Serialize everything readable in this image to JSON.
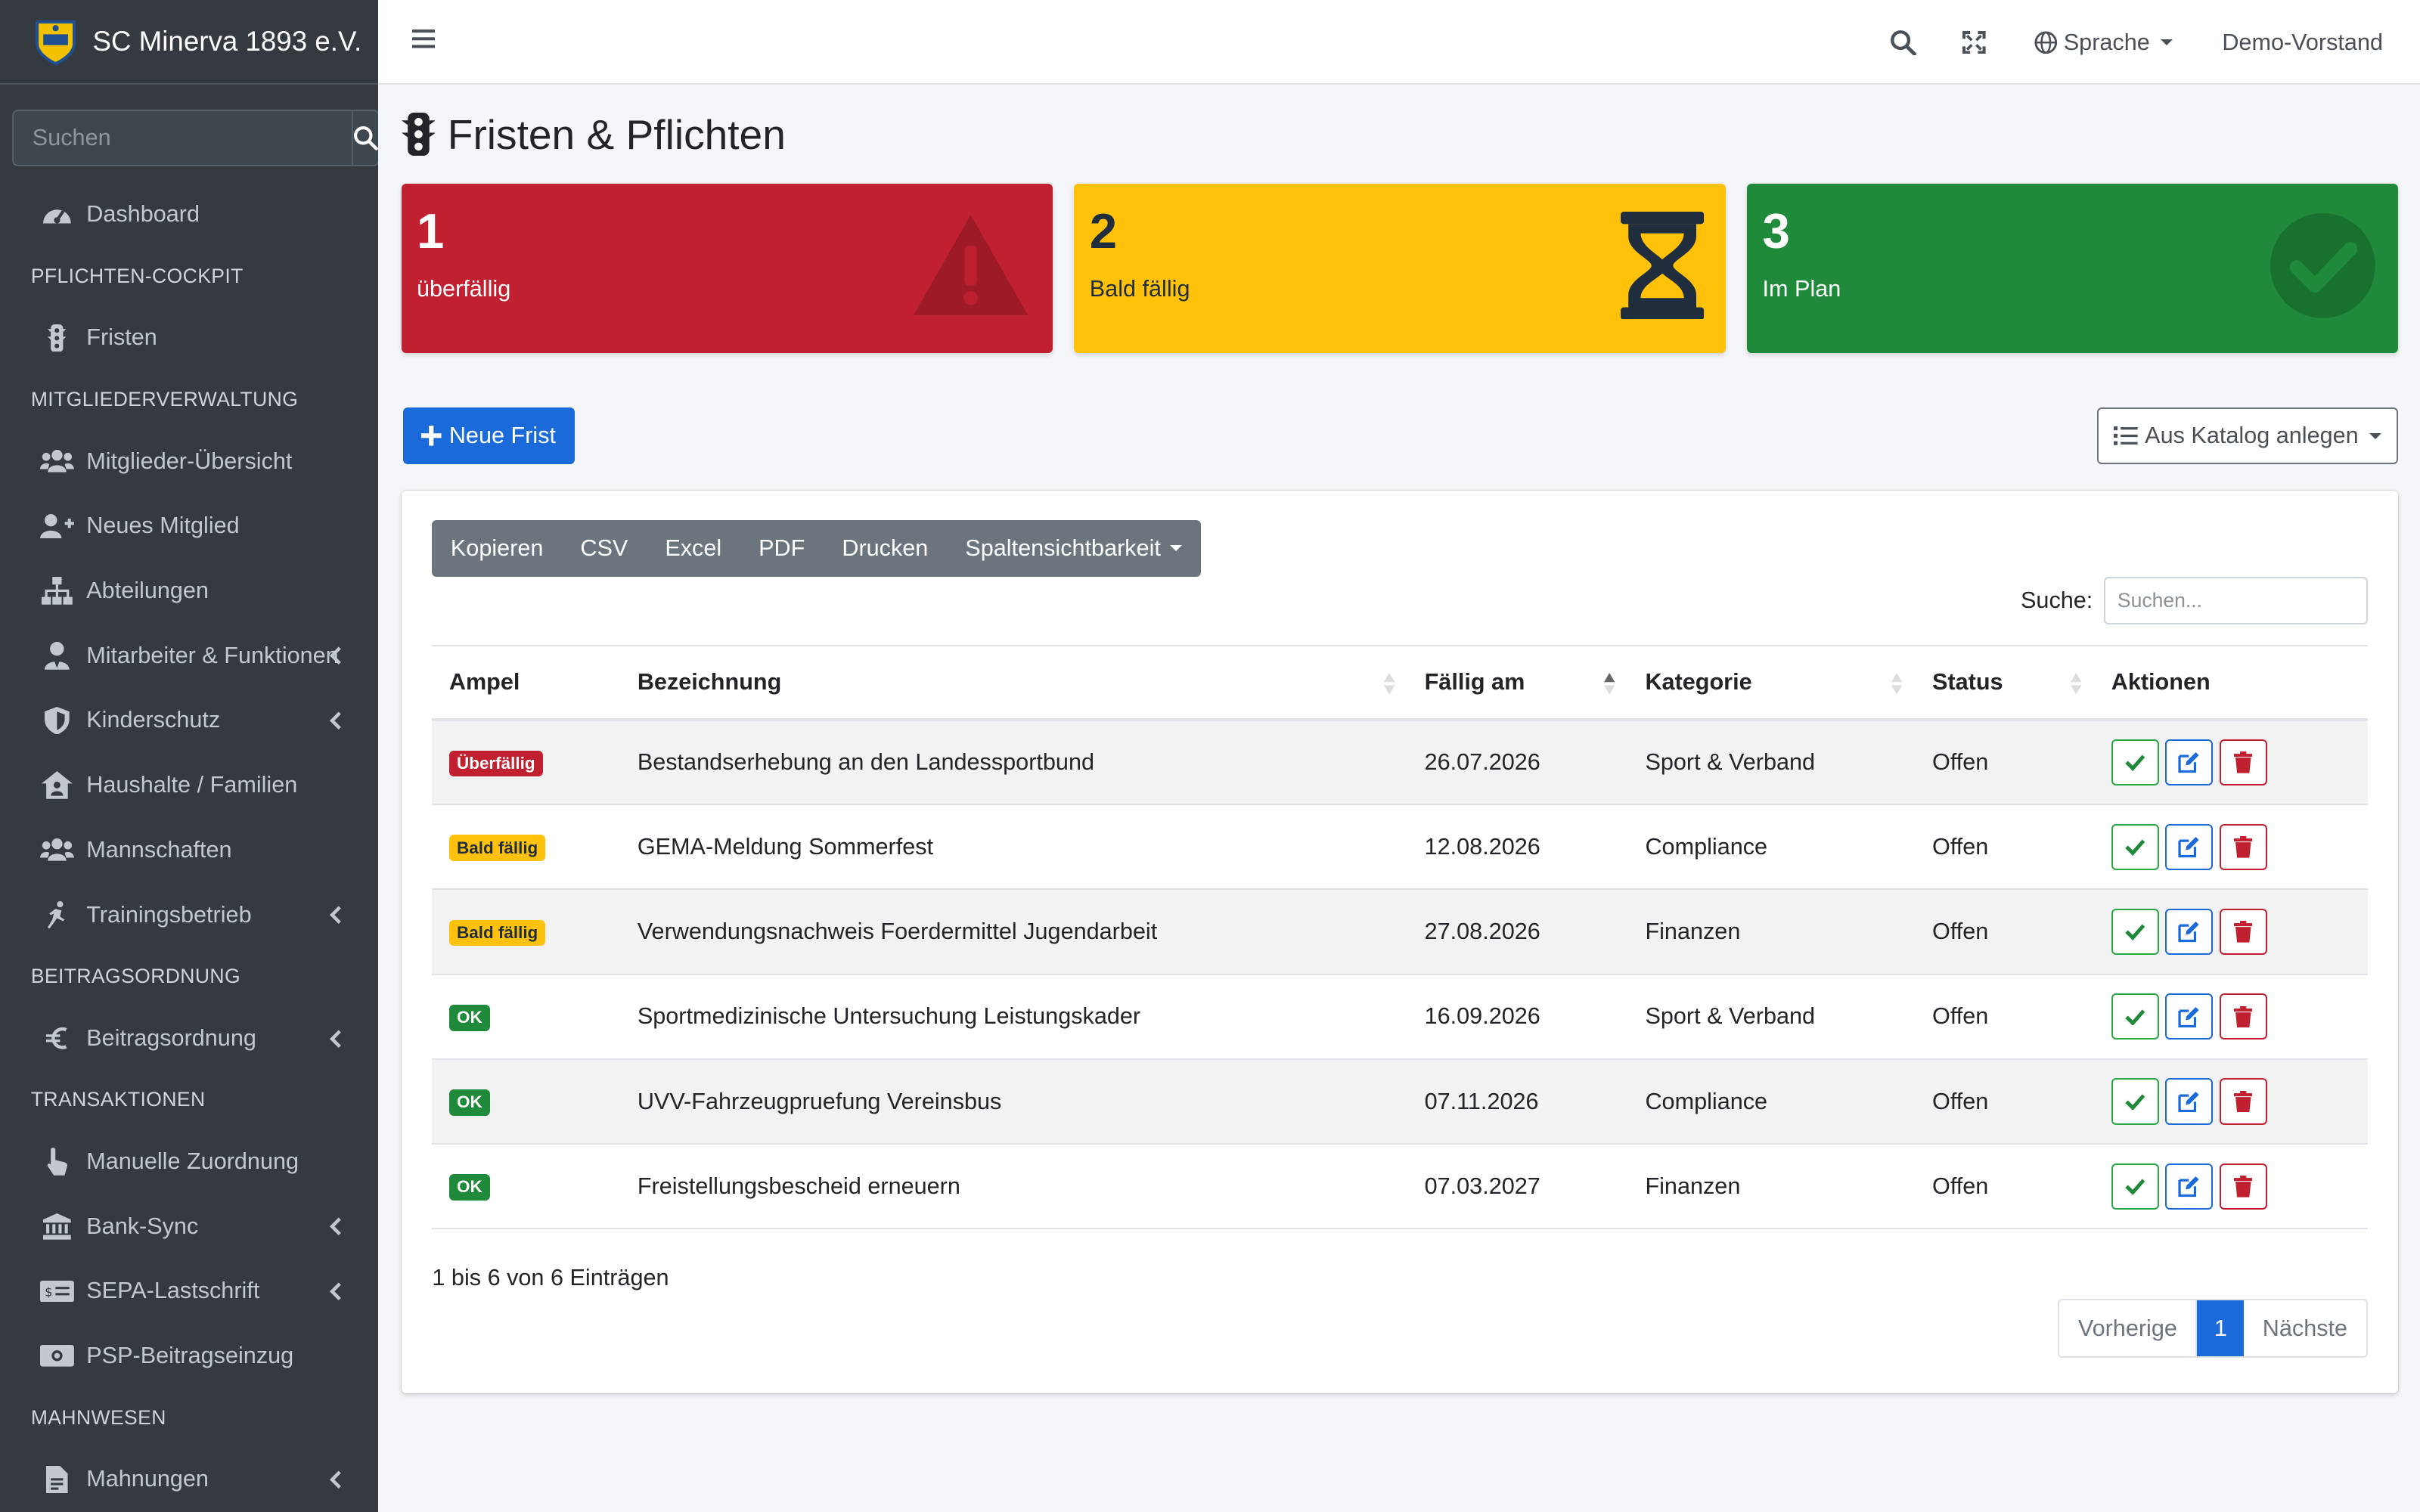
{
  "brand": {
    "name": "SC Minerva 1893 e.V."
  },
  "sidebar": {
    "search_placeholder": "Suchen",
    "items": [
      {
        "type": "item",
        "label": "Dashboard",
        "icon": "tachometer-icon"
      },
      {
        "type": "header",
        "label": "PFLICHTEN-COCKPIT"
      },
      {
        "type": "item",
        "label": "Fristen",
        "icon": "traffic-light-icon"
      },
      {
        "type": "header",
        "label": "MITGLIEDERVERWALTUNG"
      },
      {
        "type": "item",
        "label": "Mitglieder-Übersicht",
        "icon": "users-icon"
      },
      {
        "type": "item",
        "label": "Neues Mitglied",
        "icon": "user-plus-icon"
      },
      {
        "type": "item",
        "label": "Abteilungen",
        "icon": "sitemap-icon"
      },
      {
        "type": "item",
        "label": "Mitarbeiter & Funktionen",
        "icon": "user-tie-icon",
        "chevron": true
      },
      {
        "type": "item",
        "label": "Kinderschutz",
        "icon": "shield-icon",
        "chevron": true
      },
      {
        "type": "item",
        "label": "Haushalte / Familien",
        "icon": "house-user-icon"
      },
      {
        "type": "item",
        "label": "Mannschaften",
        "icon": "users-icon"
      },
      {
        "type": "item",
        "label": "Trainingsbetrieb",
        "icon": "running-icon",
        "chevron": true
      },
      {
        "type": "header",
        "label": "BEITRAGSORDNUNG"
      },
      {
        "type": "item",
        "label": "Beitragsordnung",
        "icon": "euro-icon",
        "chevron": true
      },
      {
        "type": "header",
        "label": "TRANSAKTIONEN"
      },
      {
        "type": "item",
        "label": "Manuelle Zuordnung",
        "icon": "hand-pointer-icon"
      },
      {
        "type": "item",
        "label": "Bank-Sync",
        "icon": "bank-icon",
        "chevron": true
      },
      {
        "type": "item",
        "label": "SEPA-Lastschrift",
        "icon": "money-check-icon",
        "chevron": true
      },
      {
        "type": "item",
        "label": "PSP-Beitragseinzug",
        "icon": "money-bill-icon"
      },
      {
        "type": "header",
        "label": "MAHNWESEN"
      },
      {
        "type": "item",
        "label": "Mahnungen",
        "icon": "file-invoice-icon",
        "chevron": true
      }
    ]
  },
  "topbar": {
    "language_label": "Sprache",
    "user_label": "Demo-Vorstand"
  },
  "page": {
    "title": "Fristen & Pflichten"
  },
  "stats": [
    {
      "number": "1",
      "label": "überfällig",
      "color": "#c0202f",
      "icon": "warning-icon"
    },
    {
      "number": "2",
      "label": "Bald fällig",
      "color": "#ffc10a",
      "icon": "hourglass-icon"
    },
    {
      "number": "3",
      "label": "Im Plan",
      "color": "#1e8a3a",
      "icon": "check-circle-icon"
    }
  ],
  "buttons": {
    "new": "Neue Frist",
    "catalog": "Aus Katalog anlegen"
  },
  "dt_buttons": [
    "Kopieren",
    "CSV",
    "Excel",
    "PDF",
    "Drucken",
    "Spaltensichtbarkeit"
  ],
  "search": {
    "label": "Suche:",
    "placeholder": "Suchen..."
  },
  "table": {
    "columns": [
      "Ampel",
      "Bezeichnung",
      "Fällig am",
      "Kategorie",
      "Status",
      "Aktionen"
    ],
    "rows": [
      {
        "badge": "Überfällig",
        "badge_type": "red",
        "name": "Bestandserhebung an den Landessportbund",
        "date": "26.07.2026",
        "category": "Sport & Verband",
        "status": "Offen"
      },
      {
        "badge": "Bald fällig",
        "badge_type": "yellow",
        "name": "GEMA-Meldung Sommerfest",
        "date": "12.08.2026",
        "category": "Compliance",
        "status": "Offen"
      },
      {
        "badge": "Bald fällig",
        "badge_type": "yellow",
        "name": "Verwendungsnachweis Foerdermittel Jugendarbeit",
        "date": "27.08.2026",
        "category": "Finanzen",
        "status": "Offen"
      },
      {
        "badge": "OK",
        "badge_type": "green",
        "name": "Sportmedizinische Untersuchung Leistungskader",
        "date": "16.09.2026",
        "category": "Sport & Verband",
        "status": "Offen"
      },
      {
        "badge": "OK",
        "badge_type": "green",
        "name": "UVV-Fahrzeugpruefung Vereinsbus",
        "date": "07.11.2026",
        "category": "Compliance",
        "status": "Offen"
      },
      {
        "badge": "OK",
        "badge_type": "green",
        "name": "Freistellungsbescheid erneuern",
        "date": "07.03.2027",
        "category": "Finanzen",
        "status": "Offen"
      }
    ]
  },
  "info": "1 bis 6 von 6 Einträgen",
  "pager": {
    "prev": "Vorherige",
    "current": "1",
    "next": "Nächste"
  }
}
